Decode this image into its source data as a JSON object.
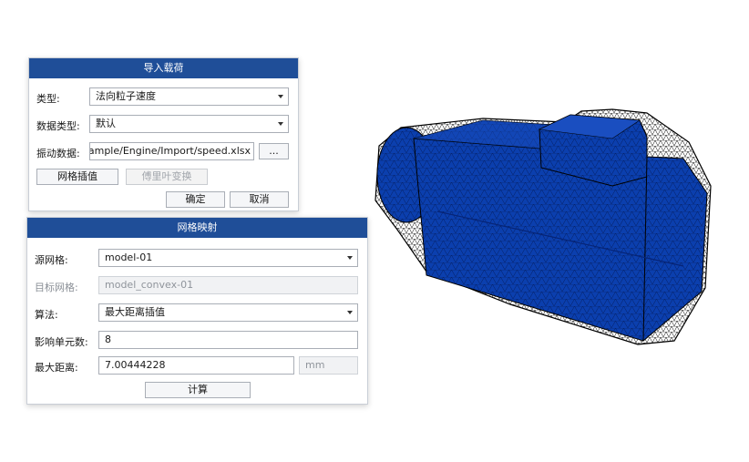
{
  "import_dialog": {
    "title": "导入载荷",
    "type_label": "类型:",
    "type_value": "法向粒子速度",
    "data_type_label": "数据类型:",
    "data_type_value": "默认",
    "vibration_data_label": "振动数据:",
    "vibration_data_value": "Example/Engine/Import/speed.xlsx",
    "browse_label": "...",
    "grid_interp_label": "网格插值",
    "fourier_label": "傅里叶变换",
    "ok_label": "确定",
    "cancel_label": "取消"
  },
  "mapping_dialog": {
    "title": "网格映射",
    "source_mesh_label": "源网格:",
    "source_mesh_value": "model-01",
    "target_mesh_label": "目标网格:",
    "target_mesh_value": "model_convex-01",
    "method_label": "算法:",
    "method_value": "最大距离插值",
    "influence_label": "影响单元数:",
    "influence_value": "8",
    "max_dist_label": "最大距离:",
    "max_dist_value": "7.00444228",
    "unit_value": "mm",
    "compute_label": "计算"
  },
  "colors": {
    "title_bar": "#1f4e98",
    "mesh_fill": "#0b3fae",
    "mesh_edge": "#000000"
  }
}
